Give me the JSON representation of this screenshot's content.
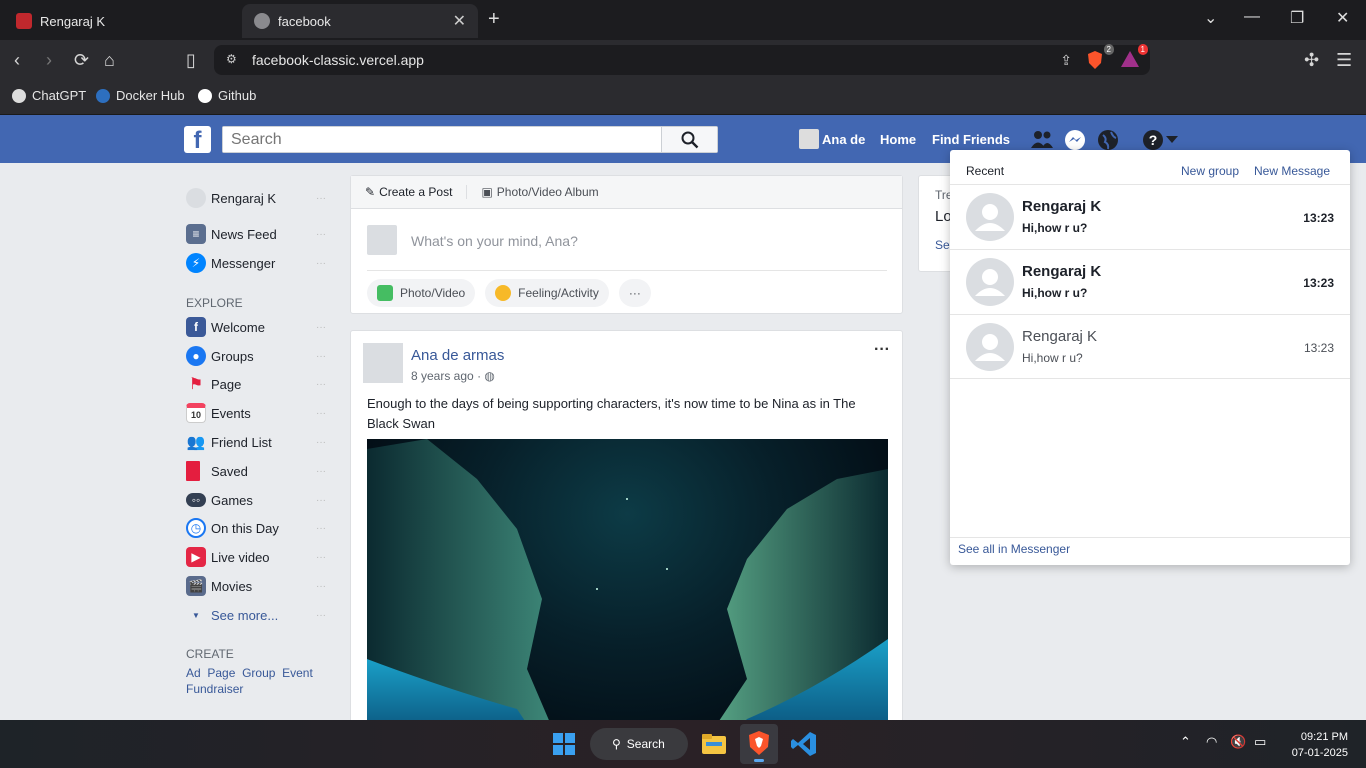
{
  "browser": {
    "tabs": [
      {
        "label": "Rengaraj K",
        "active": false
      },
      {
        "label": "facebook",
        "active": true
      }
    ],
    "url": "facebook-classic.vercel.app",
    "brave_shield_badge": "2",
    "rewards_badge": "1",
    "bookmarks": [
      "ChatGPT",
      "Docker Hub",
      "Github"
    ]
  },
  "fb_header": {
    "logo": "f",
    "search_placeholder": "Search",
    "user_name": "Ana de",
    "home": "Home",
    "find_friends": "Find Friends"
  },
  "sidebar": {
    "user": "Rengaraj K",
    "main": [
      {
        "label": "News Feed",
        "icon": "news-feed-icon",
        "color": "#5b6e8f"
      },
      {
        "label": "Messenger",
        "icon": "messenger-icon",
        "color": "#0084ff"
      }
    ],
    "explore_header": "EXPLORE",
    "explore": [
      {
        "label": "Welcome",
        "icon": "facebook-icon",
        "color": "#3b5998"
      },
      {
        "label": "Groups",
        "icon": "groups-icon",
        "color": "#1a77f2"
      },
      {
        "label": "Page",
        "icon": "flag-icon",
        "color": "#e41e3f"
      },
      {
        "label": "Events",
        "icon": "calendar-icon",
        "color": "#f3425f"
      },
      {
        "label": "Friend List",
        "icon": "friends-icon",
        "color": "#1a77f2"
      },
      {
        "label": "Saved",
        "icon": "bookmark-icon",
        "color": "#e41e3f"
      },
      {
        "label": "Games",
        "icon": "gamepad-icon",
        "color": "#333f52"
      },
      {
        "label": "On this Day",
        "icon": "clock-icon",
        "color": "#1a77f2"
      },
      {
        "label": "Live video",
        "icon": "live-video-icon",
        "color": "#e42645"
      },
      {
        "label": "Movies",
        "icon": "movies-icon",
        "color": "#5a6b8c"
      }
    ],
    "see_more": "See more...",
    "create_header": "CREATE",
    "create_links": [
      "Ad",
      "Page",
      "Group",
      "Event",
      "Fundraiser"
    ]
  },
  "composer": {
    "tab_create": "Create a Post",
    "tab_album": "Photo/Video Album",
    "placeholder": "What's on your mind, Ana?",
    "btn_photo": "Photo/Video",
    "btn_feeling": "Feeling/Activity",
    "btn_more": "···"
  },
  "post": {
    "author": "Ana de armas",
    "time": "8 years ago",
    "text": "Enough to the days of being supporting characters, it's now time to be Nina as in The Black Swan",
    "more": "···"
  },
  "trending": {
    "title": "Tre",
    "line": "Lo",
    "link": "Se"
  },
  "messenger_dropdown": {
    "header": "Recent",
    "new_group": "New group",
    "new_message": "New Message",
    "messages": [
      {
        "name": "Rengaraj K",
        "text": "Hi,how r u?",
        "time": "13:23",
        "unread": true
      },
      {
        "name": "Rengaraj K",
        "text": "Hi,how r u?",
        "time": "13:23",
        "unread": true
      },
      {
        "name": "Rengaraj K",
        "text": "Hi,how r u?",
        "time": "13:23",
        "unread": false
      }
    ],
    "see_all": "See all in Messenger"
  },
  "taskbar": {
    "search": "Search",
    "time": "09:21 PM",
    "date": "07-01-2025"
  }
}
